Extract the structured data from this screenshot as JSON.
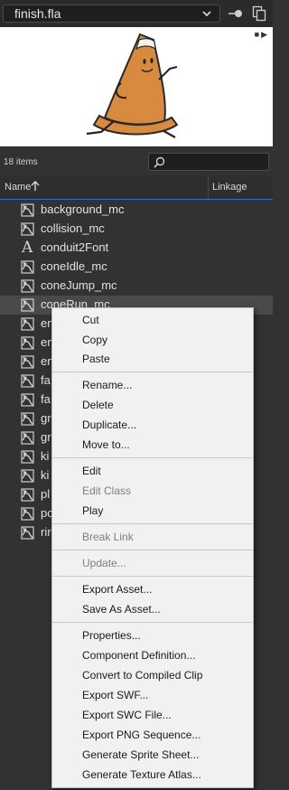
{
  "document": {
    "title": "finish.fla"
  },
  "library": {
    "item_count": "18 items",
    "columns": {
      "name": "Name",
      "linkage": "Linkage"
    },
    "items": [
      {
        "label": "background_mc",
        "type": "movie-clip"
      },
      {
        "label": "collision_mc",
        "type": "movie-clip"
      },
      {
        "label": "conduit2Font",
        "type": "font"
      },
      {
        "label": "coneIdle_mc",
        "type": "movie-clip"
      },
      {
        "label": "coneJump_mc",
        "type": "movie-clip"
      },
      {
        "label": "coneRun_mc",
        "type": "movie-clip",
        "selected": true
      },
      {
        "label": "en",
        "type": "movie-clip"
      },
      {
        "label": "en",
        "type": "movie-clip"
      },
      {
        "label": "en",
        "type": "movie-clip"
      },
      {
        "label": "fa",
        "type": "movie-clip"
      },
      {
        "label": "fa",
        "type": "movie-clip"
      },
      {
        "label": "gr",
        "type": "movie-clip"
      },
      {
        "label": "gr",
        "type": "movie-clip"
      },
      {
        "label": "ki",
        "type": "movie-clip"
      },
      {
        "label": "ki",
        "type": "movie-clip"
      },
      {
        "label": "pl",
        "type": "movie-clip"
      },
      {
        "label": "po",
        "type": "movie-clip"
      },
      {
        "label": "rir",
        "type": "movie-clip"
      }
    ]
  },
  "context_menu": {
    "items": [
      {
        "label": "Cut",
        "enabled": true
      },
      {
        "label": "Copy",
        "enabled": true
      },
      {
        "label": "Paste",
        "enabled": true
      },
      {
        "label": "Rename...",
        "enabled": true
      },
      {
        "label": "Delete",
        "enabled": true
      },
      {
        "label": "Duplicate...",
        "enabled": true
      },
      {
        "label": "Move to...",
        "enabled": true
      },
      {
        "label": "Edit",
        "enabled": true
      },
      {
        "label": "Edit Class",
        "enabled": false
      },
      {
        "label": "Play",
        "enabled": true
      },
      {
        "label": "Break Link",
        "enabled": false
      },
      {
        "label": "Update...",
        "enabled": false
      },
      {
        "label": "Export Asset...",
        "enabled": true
      },
      {
        "label": "Save As Asset...",
        "enabled": true
      },
      {
        "label": "Properties...",
        "enabled": true
      },
      {
        "label": "Component Definition...",
        "enabled": true
      },
      {
        "label": "Convert to Compiled Clip",
        "enabled": true
      },
      {
        "label": "Export SWF...",
        "enabled": true
      },
      {
        "label": "Export SWC File...",
        "enabled": true
      },
      {
        "label": "Export PNG Sequence...",
        "enabled": true
      },
      {
        "label": "Generate Sprite Sheet...",
        "enabled": true
      },
      {
        "label": "Generate Texture Atlas...",
        "enabled": true
      }
    ]
  },
  "colors": {
    "accent": "#2d6fc4",
    "cone": "#d88a3e",
    "panel": "#323232",
    "menu": "#f1f1f1"
  },
  "icons": {
    "doc_select": "chevron-down-icon",
    "pin": "pin-icon",
    "duplicate": "duplicate-icon",
    "search": "search-icon",
    "sort": "sort-ascending-icon",
    "movie_clip": "movie-clip-icon",
    "font": "font-icon"
  }
}
